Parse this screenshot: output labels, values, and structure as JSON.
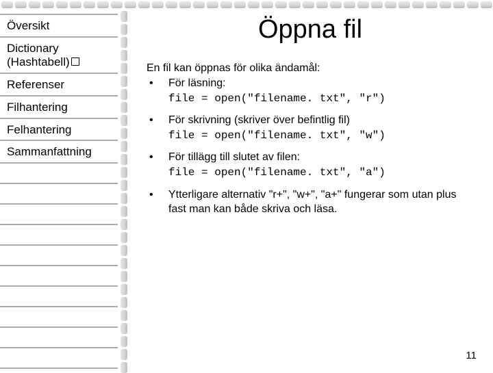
{
  "sidebar": {
    "items": [
      {
        "label": "Översikt"
      },
      {
        "label": "Dictionary (Hashtabell)",
        "box": true
      },
      {
        "label": "Referenser"
      },
      {
        "label": "Filhantering"
      },
      {
        "label": "Felhantering"
      },
      {
        "label": "Sammanfattning"
      }
    ]
  },
  "content": {
    "title": "Öppna fil",
    "intro": "En fil kan öppnas för olika ändamål:",
    "bullets": [
      {
        "lead": "För läsning:",
        "code": "file = open(\"filename. txt\", \"r\")"
      },
      {
        "lead": "För skrivning (skriver över befintlig fil)",
        "code": "file = open(\"filename. txt\", \"w\")"
      },
      {
        "lead": "För tillägg till slutet av filen:",
        "code": "file = open(\"filename. txt\", \"a\")"
      },
      {
        "lead": "Ytterligare alternativ \"r+\", \"w+\", \"a+\" fungerar som utan plus fast man kan både skriva och läsa."
      }
    ],
    "page_number": "11"
  }
}
